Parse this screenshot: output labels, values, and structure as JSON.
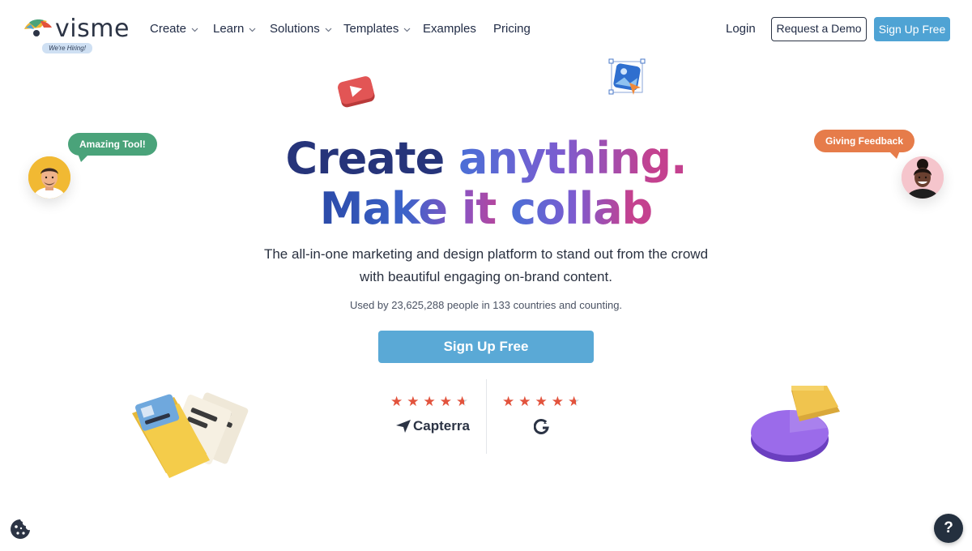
{
  "brand": {
    "logo_text": "visme",
    "hiring_badge": "We're Hiring!"
  },
  "nav": {
    "items": [
      {
        "label": "Create",
        "has_dropdown": true
      },
      {
        "label": "Learn",
        "has_dropdown": true
      },
      {
        "label": "Solutions",
        "has_dropdown": true
      },
      {
        "label": "Templates",
        "has_dropdown": true
      },
      {
        "label": "Examples",
        "has_dropdown": false
      },
      {
        "label": "Pricing",
        "has_dropdown": false
      }
    ],
    "login": "Login",
    "demo_button": "Request a Demo",
    "signup_button": "Sign Up Free"
  },
  "hero": {
    "line1_part1": "Create ",
    "line1_part2": "anything.",
    "line2_part1": "Make it ",
    "line2_part2": "collab",
    "subtitle_line1": "The all-in-one marketing and design platform to stand out from the crowd",
    "subtitle_line2": "with beautiful engaging on-brand content.",
    "usage": "Used by 23,625,288 people in 133 countries and counting.",
    "cta": "Sign Up Free"
  },
  "ratings": [
    {
      "source": "Capterra",
      "stars": 4.5,
      "icon": "capterra-logo-icon"
    },
    {
      "source": "G2",
      "stars": 4.5,
      "icon": "g2-logo-icon"
    }
  ],
  "testimonials": {
    "left_bubble": "Amazing Tool!",
    "right_bubble": "Giving Feedback"
  },
  "colors": {
    "accent": "#4fa3d4",
    "star": "#e2533d",
    "bubble_green": "#4aa37a",
    "bubble_orange": "#e67c4a",
    "text_dark": "#1f2a44"
  },
  "help_button": "?"
}
